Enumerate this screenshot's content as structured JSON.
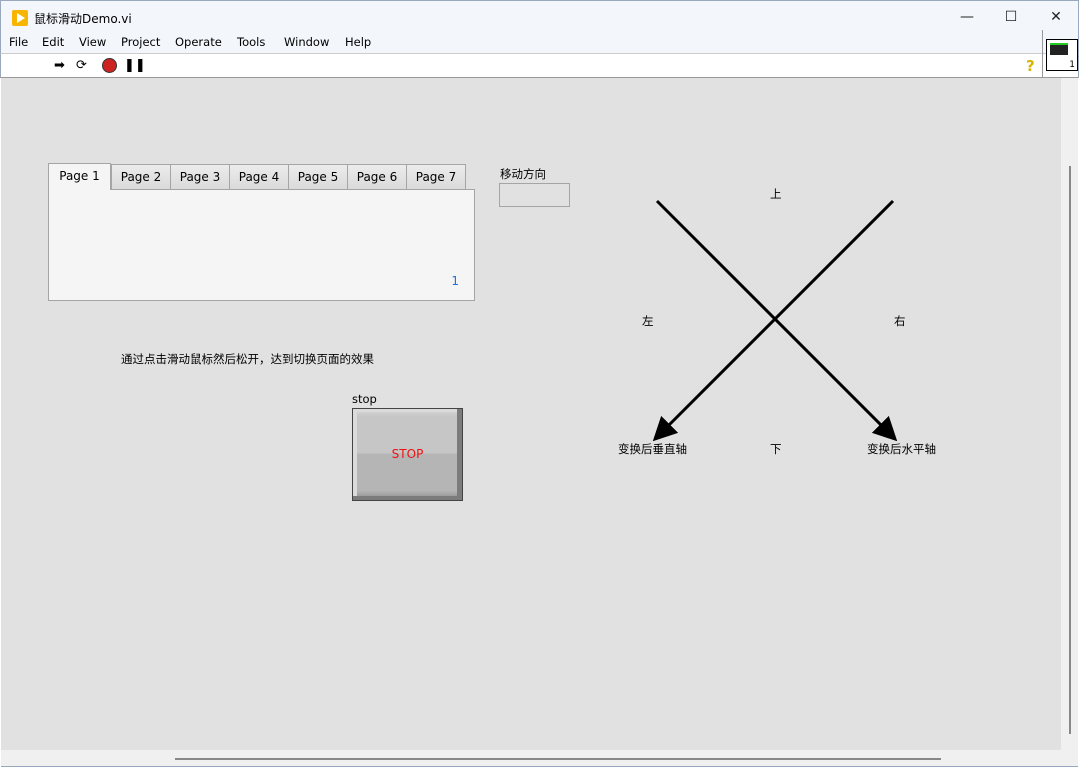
{
  "window": {
    "title": "鼠标滑动Demo.vi",
    "minimize": "—",
    "maximize": "☐",
    "close": "✕"
  },
  "menu": [
    "File",
    "Edit",
    "View",
    "Project",
    "Operate",
    "Tools",
    "Window",
    "Help"
  ],
  "toolbar": {
    "run": "run-arrow",
    "run_continuous": "run-continuously",
    "abort": "abort",
    "pause": "pause",
    "help": "?"
  },
  "tabs": {
    "labels": [
      "Page 1",
      "Page 2",
      "Page 3",
      "Page 4",
      "Page 5",
      "Page 6",
      "Page 7"
    ],
    "active": 0,
    "page_number": "1"
  },
  "direction": {
    "label": "移动方向",
    "value": ""
  },
  "hint": "通过点击滑动鼠标然后松开，达到切换页面的效果",
  "stop": {
    "label": "stop",
    "button": "STOP"
  },
  "diagram": {
    "up": "上",
    "down": "下",
    "left": "左",
    "right": "右",
    "vertical_axis": "变换后垂直轴",
    "horizontal_axis": "变换后水平轴"
  }
}
